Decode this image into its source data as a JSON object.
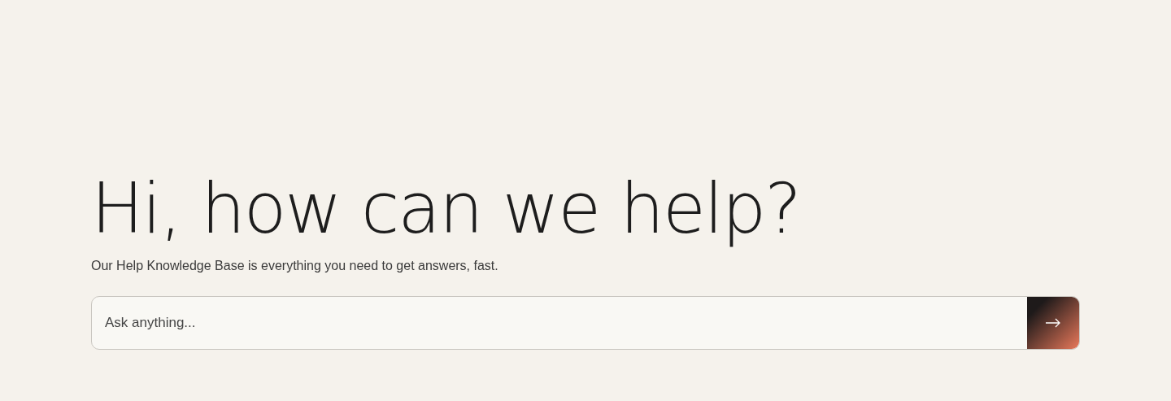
{
  "hero": {
    "heading": "Hi, how can we help?",
    "subtitle": "Our Help Knowledge Base is everything you need to get answers, fast."
  },
  "search": {
    "placeholder": "Ask anything..."
  }
}
